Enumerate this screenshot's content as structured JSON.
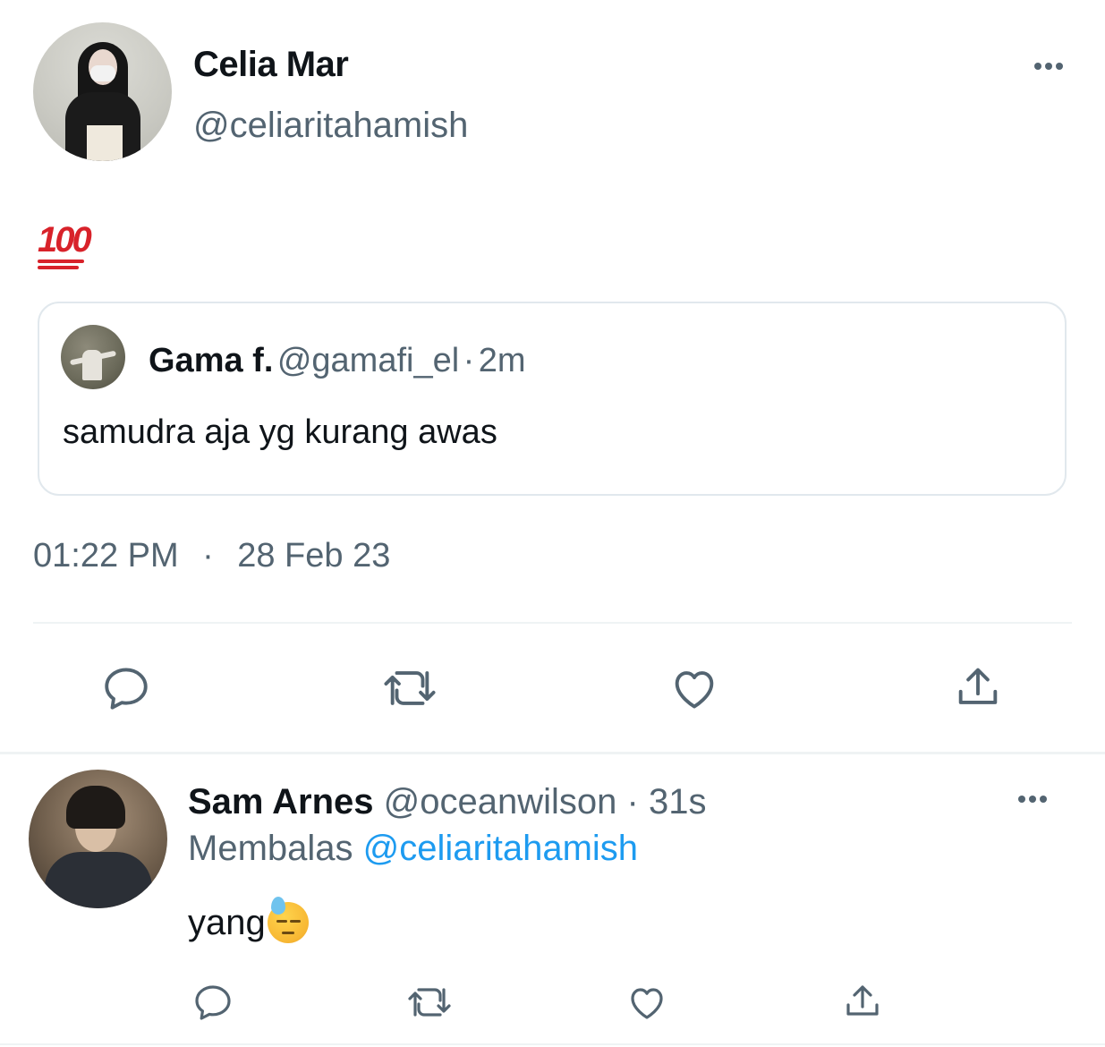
{
  "main_tweet": {
    "display_name": "Celia Mar",
    "handle": "@celiaritahamish",
    "text": "💯",
    "timestamp_time": "01:22 PM",
    "timestamp_sep": "·",
    "timestamp_date": "28 Feb 23",
    "avatar_icon": "user-photo"
  },
  "quoted_tweet": {
    "display_name": "Gama f.",
    "handle": "@gamafi_el",
    "sep": "·",
    "time": "2m",
    "text": "samudra aja yg kurang awas"
  },
  "reply_tweet": {
    "display_name": "Sam Arnes",
    "handle": "@oceanwilson",
    "sep": "·",
    "time": "31s",
    "replying_prefix": "Membalas",
    "replying_to": "@celiaritahamish",
    "text": "yang"
  },
  "actions": [
    "reply-icon",
    "retweet-icon",
    "like-icon",
    "share-icon"
  ],
  "colors": {
    "secondary_text": "#536471",
    "link": "#1d9bf0",
    "border": "#e1e8ed"
  }
}
